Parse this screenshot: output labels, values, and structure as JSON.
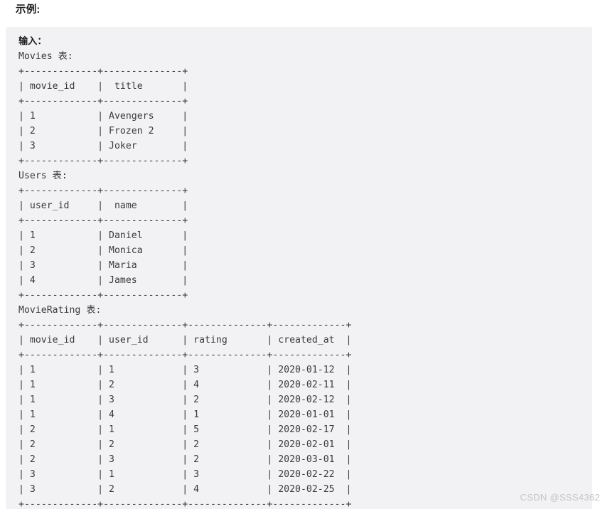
{
  "page": {
    "heading": "示例:",
    "watermark": "CSDN @SSS4362",
    "background_color": "#ffffff",
    "code_block_color": "#f2f2f4",
    "text_color": "#3b3b3b"
  },
  "code_block": {
    "input_label": "输入：",
    "lines": [
      "输入：",
      "Movies 表:",
      "+-------------+--------------+",
      "| movie_id    |  title       |",
      "+-------------+--------------+",
      "| 1           | Avengers     |",
      "| 2           | Frozen 2     |",
      "| 3           | Joker        |",
      "+-------------+--------------+",
      "Users 表:",
      "+-------------+--------------+",
      "| user_id     |  name        |",
      "+-------------+--------------+",
      "| 1           | Daniel       |",
      "| 2           | Monica       |",
      "| 3           | Maria        |",
      "| 4           | James        |",
      "+-------------+--------------+",
      "MovieRating 表:",
      "+-------------+--------------+--------------+-------------+",
      "| movie_id    | user_id      | rating       | created_at  |",
      "+-------------+--------------+--------------+-------------+",
      "| 1           | 1            | 3            | 2020-01-12  |",
      "| 1           | 2            | 4            | 2020-02-11  |",
      "| 1           | 3            | 2            | 2020-02-12  |",
      "| 1           | 4            | 1            | 2020-01-01  |",
      "| 2           | 1            | 5            | 2020-02-17  |",
      "| 2           | 2            | 2            | 2020-02-01  |",
      "| 2           | 3            | 2            | 2020-03-01  |",
      "| 3           | 1            | 3            | 2020-02-22  |",
      "| 3           | 2            | 4            | 2020-02-25  |",
      "+-------------+--------------+--------------+-------------+"
    ],
    "tables": [
      {
        "name": "Movies",
        "label": "Movies 表:",
        "columns": [
          "movie_id",
          "title"
        ],
        "rows": [
          [
            "1",
            "Avengers"
          ],
          [
            "2",
            "Frozen 2"
          ],
          [
            "3",
            "Joker"
          ]
        ]
      },
      {
        "name": "Users",
        "label": "Users 表:",
        "columns": [
          "user_id",
          "name"
        ],
        "rows": [
          [
            "1",
            "Daniel"
          ],
          [
            "2",
            "Monica"
          ],
          [
            "3",
            "Maria"
          ],
          [
            "4",
            "James"
          ]
        ]
      },
      {
        "name": "MovieRating",
        "label": "MovieRating 表:",
        "columns": [
          "movie_id",
          "user_id",
          "rating",
          "created_at"
        ],
        "rows": [
          [
            "1",
            "1",
            "3",
            "2020-01-12"
          ],
          [
            "1",
            "2",
            "4",
            "2020-02-11"
          ],
          [
            "1",
            "3",
            "2",
            "2020-02-12"
          ],
          [
            "1",
            "4",
            "1",
            "2020-01-01"
          ],
          [
            "2",
            "1",
            "5",
            "2020-02-17"
          ],
          [
            "2",
            "2",
            "2",
            "2020-02-01"
          ],
          [
            "2",
            "3",
            "2",
            "2020-03-01"
          ],
          [
            "3",
            "1",
            "3",
            "2020-02-22"
          ],
          [
            "3",
            "2",
            "4",
            "2020-02-25"
          ]
        ]
      }
    ]
  }
}
